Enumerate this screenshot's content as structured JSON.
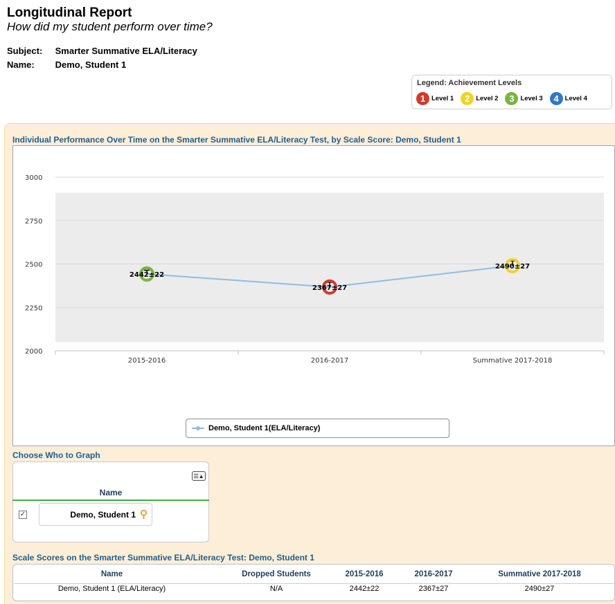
{
  "header": {
    "title": "Longitudinal Report",
    "subtitle": "How did my student perform over time?",
    "subject_label": "Subject:",
    "subject_value": "Smarter Summative ELA/Literacy",
    "name_label": "Name:",
    "name_value": "Demo, Student 1"
  },
  "legend": {
    "title": "Legend: Achievement Levels",
    "levels": [
      {
        "number": "1",
        "label": "Level 1",
        "color": "#d23a2b"
      },
      {
        "number": "2",
        "label": "Level 2",
        "color": "#f2d12a"
      },
      {
        "number": "3",
        "label": "Level 3",
        "color": "#79b43e"
      },
      {
        "number": "4",
        "label": "Level 4",
        "color": "#2f78c4"
      }
    ]
  },
  "chart_title": "Individual Performance Over Time on the Smarter Summative ELA/Literacy Test, by Scale Score: Demo, Student 1",
  "chart_data": {
    "type": "line",
    "categories": [
      "2015-2016",
      "2016-2017",
      "Summative 2017-2018"
    ],
    "series": [
      {
        "name": "Demo, Student 1(ELA/Literacy)",
        "values": [
          2442,
          2367,
          2490
        ],
        "errors": [
          22,
          27,
          27
        ],
        "labels": [
          "2442±22",
          "2367±27",
          "2490±27"
        ],
        "levels": [
          3,
          1,
          2
        ],
        "color": "#8fbbe6"
      }
    ],
    "yticks": [
      2000,
      2250,
      2500,
      2750,
      3000
    ],
    "ylim": [
      2000,
      3000
    ],
    "band": [
      2050,
      2910
    ],
    "grid": true,
    "legend_position": "bottom"
  },
  "choose": {
    "title": "Choose Who to Graph",
    "column_header": "Name",
    "toggle_icon": "list-toggle-icon",
    "rows": [
      {
        "name": "Demo, Student 1",
        "checked": true
      }
    ]
  },
  "scores_table": {
    "title": "Scale Scores on the Smarter Summative ELA/Literacy Test: Demo, Student 1",
    "headers": [
      "Name",
      "Dropped Students",
      "2015-2016",
      "2016-2017",
      "Summative 2017-2018"
    ],
    "rows": [
      [
        "Demo, Student 1 (ELA/Literacy)",
        "N/A",
        "2442±22",
        "2367±27",
        "2490±27"
      ]
    ]
  }
}
